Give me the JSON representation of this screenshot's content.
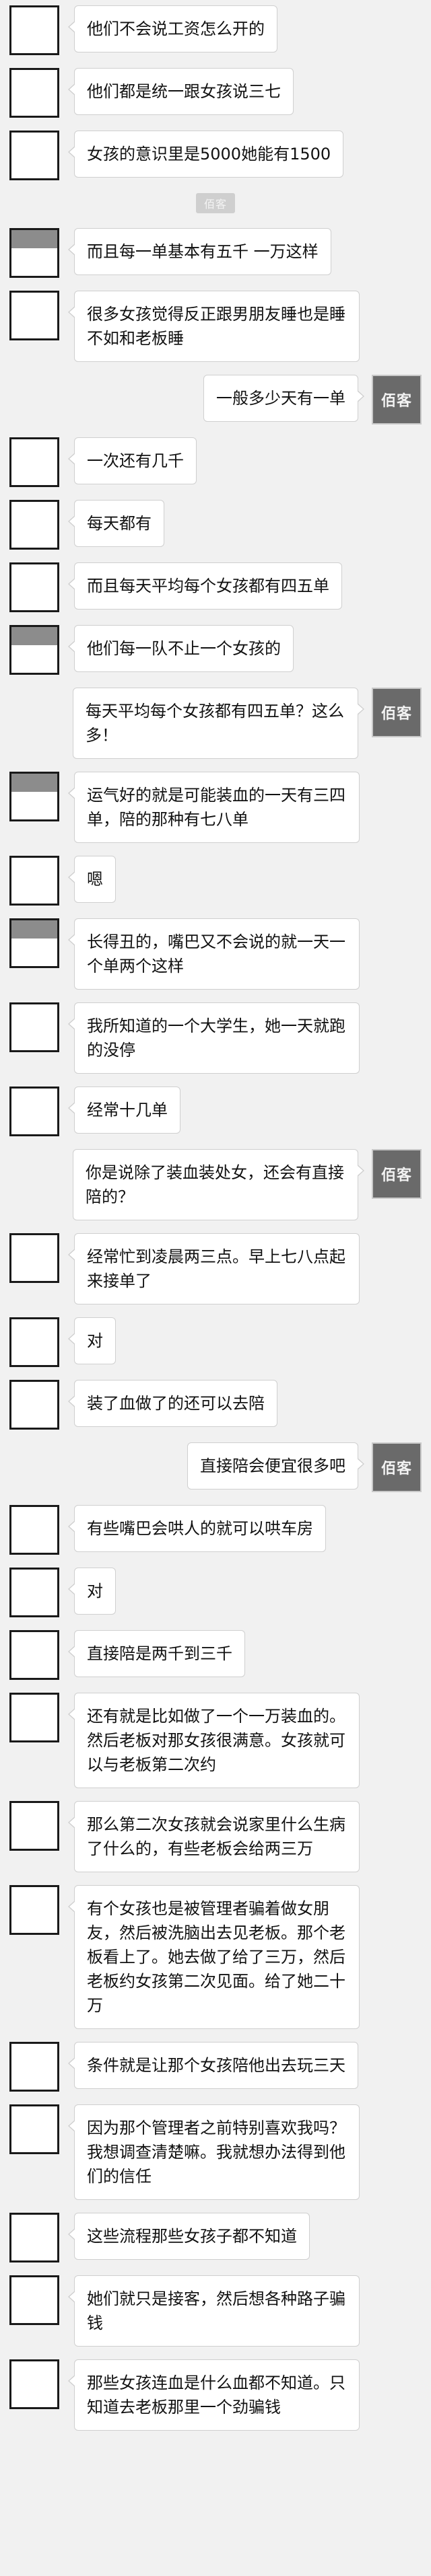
{
  "right_avatar_text": "佰客",
  "system_label": "佰客",
  "messages": [
    {
      "side": "left",
      "avatar": "plain",
      "text": "他们不会说工资怎么开的"
    },
    {
      "side": "left",
      "avatar": "plain",
      "text": "他们都是统一跟女孩说三七"
    },
    {
      "side": "left",
      "avatar": "plain",
      "text": "女孩的意识里是5000她能有1500"
    },
    {
      "side": "system"
    },
    {
      "side": "left",
      "avatar": "gray",
      "text": "而且每一单基本有五千 一万这样"
    },
    {
      "side": "left",
      "avatar": "plain",
      "text": "很多女孩觉得反正跟男朋友睡也是睡不如和老板睡"
    },
    {
      "side": "right",
      "text": "一般多少天有一单"
    },
    {
      "side": "left",
      "avatar": "plain",
      "text": "一次还有几千"
    },
    {
      "side": "left",
      "avatar": "plain",
      "text": "每天都有"
    },
    {
      "side": "left",
      "avatar": "plain",
      "text": "而且每天平均每个女孩都有四五单"
    },
    {
      "side": "left",
      "avatar": "gray",
      "text": "他们每一队不止一个女孩的"
    },
    {
      "side": "right",
      "text": "每天平均每个女孩都有四五单？这么多！"
    },
    {
      "side": "left",
      "avatar": "gray",
      "text": "运气好的就是可能装血的一天有三四单，陪的那种有七八单"
    },
    {
      "side": "left",
      "avatar": "plain",
      "text": "嗯"
    },
    {
      "side": "left",
      "avatar": "gray",
      "text": "长得丑的，嘴巴又不会说的就一天一个单两个这样"
    },
    {
      "side": "left",
      "avatar": "plain",
      "text": "我所知道的一个大学生，她一天就跑的没停"
    },
    {
      "side": "left",
      "avatar": "plain",
      "text": "经常十几单"
    },
    {
      "side": "right",
      "text": "你是说除了装血装处女，还会有直接陪的？"
    },
    {
      "side": "left",
      "avatar": "plain",
      "text": "经常忙到凌晨两三点。早上七八点起来接单了"
    },
    {
      "side": "left",
      "avatar": "plain",
      "text": "对"
    },
    {
      "side": "left",
      "avatar": "plain",
      "text": "装了血做了的还可以去陪"
    },
    {
      "side": "right",
      "text": "直接陪会便宜很多吧"
    },
    {
      "side": "left",
      "avatar": "plain",
      "text": "有些嘴巴会哄人的就可以哄车房"
    },
    {
      "side": "left",
      "avatar": "plain",
      "text": "对"
    },
    {
      "side": "left",
      "avatar": "plain",
      "text": "直接陪是两千到三千"
    },
    {
      "side": "left",
      "avatar": "plain",
      "text": "还有就是比如做了一个一万装血的。然后老板对那女孩很满意。女孩就可以与老板第二次约"
    },
    {
      "side": "left",
      "avatar": "plain",
      "text": "那么第二次女孩就会说家里什么生病了什么的，有些老板会给两三万"
    },
    {
      "side": "left",
      "avatar": "plain",
      "text": "有个女孩也是被管理者骗着做女朋友，然后被洗脑出去见老板。那个老板看上了。她去做了给了三万，然后老板约女孩第二次见面。给了她二十万"
    },
    {
      "side": "left",
      "avatar": "plain",
      "text": "条件就是让那个女孩陪他出去玩三天"
    },
    {
      "side": "left",
      "avatar": "plain",
      "text": "因为那个管理者之前特别喜欢我吗？我想调查清楚嘛。我就想办法得到他们的信任"
    },
    {
      "side": "left",
      "avatar": "plain",
      "text": "这些流程那些女孩子都不知道"
    },
    {
      "side": "left",
      "avatar": "plain",
      "text": "她们就只是接客，然后想各种路子骗钱"
    },
    {
      "side": "left",
      "avatar": "plain",
      "text": "那些女孩连血是什么血都不知道。只知道去老板那里一个劲骗钱"
    }
  ]
}
